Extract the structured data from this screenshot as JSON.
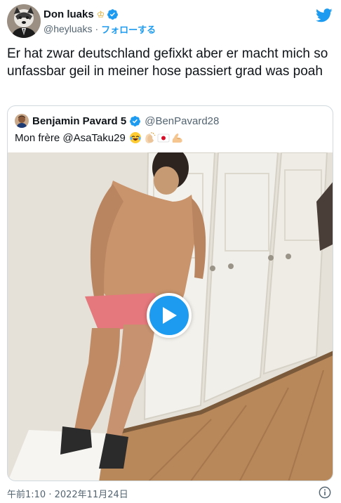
{
  "tweet": {
    "author": {
      "display_name": "Don luaks",
      "handle": "@heyluaks",
      "separator": "·",
      "follow_label": "フォローする",
      "badge_icons": [
        "crown-icon",
        "verified-badge-icon"
      ]
    },
    "text": "Er hat zwar deutschland gefixkt aber er macht mich so unfassbar geil in meiner hose passiert grad was poah",
    "quote": {
      "display_name": "Benjamin Pavard 5",
      "handle": "@BenPavard28",
      "text": "Mon frère @AsaTaku29",
      "emojis": [
        "face-with-tears-of-joy",
        "clapping-hands",
        "japan-flag",
        "flexed-biceps"
      ],
      "media": {
        "type": "video",
        "play_icon": "play-icon"
      }
    },
    "timestamp": "午前1:10 · 2022年11月24日",
    "footer_icons": [
      "info-icon"
    ]
  },
  "colors": {
    "brand_blue": "#1d9bf0",
    "text_primary": "#0f1419",
    "text_secondary": "#536471",
    "border": "#cfd9de",
    "crown_gold": "#d9a520"
  }
}
